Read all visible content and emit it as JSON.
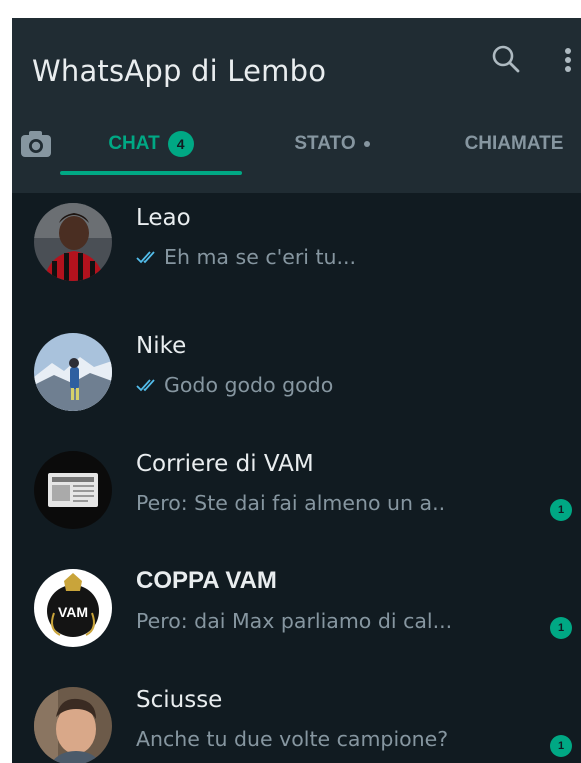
{
  "header": {
    "title": "WhatsApp di Lembo",
    "search_icon": "search-icon",
    "menu_icon": "more-vert-icon"
  },
  "tabs": {
    "camera_icon": "camera-icon",
    "chat": {
      "label": "CHAT",
      "badge": "4"
    },
    "stato": {
      "label": "STATO"
    },
    "chiamate": {
      "label": "CHIAMATE"
    }
  },
  "chats": [
    {
      "name": "Leao",
      "preview": "Eh ma se c'eri tu...",
      "read_ticks": true,
      "unread": ""
    },
    {
      "name": "Nike",
      "preview": "Godo godo godo",
      "read_ticks": true,
      "unread": ""
    },
    {
      "name": "Corriere di VAM",
      "preview": "Pero: Ste dai fai almeno un a..",
      "read_ticks": false,
      "unread": "1"
    },
    {
      "name": "COPPA VAM",
      "preview": "Pero: dai Max parliamo di cal...",
      "read_ticks": false,
      "unread": "1",
      "avatar_text": "VAM"
    },
    {
      "name": "Sciusse",
      "preview": "Anche tu due volte campione?",
      "read_ticks": false,
      "unread": "1"
    }
  ],
  "colors": {
    "background": "#111b21",
    "header": "#202c33",
    "accent": "#00a884",
    "primary_text": "#e9edef",
    "secondary_text": "#8696a0",
    "read_ticks": "#53bdeb"
  }
}
